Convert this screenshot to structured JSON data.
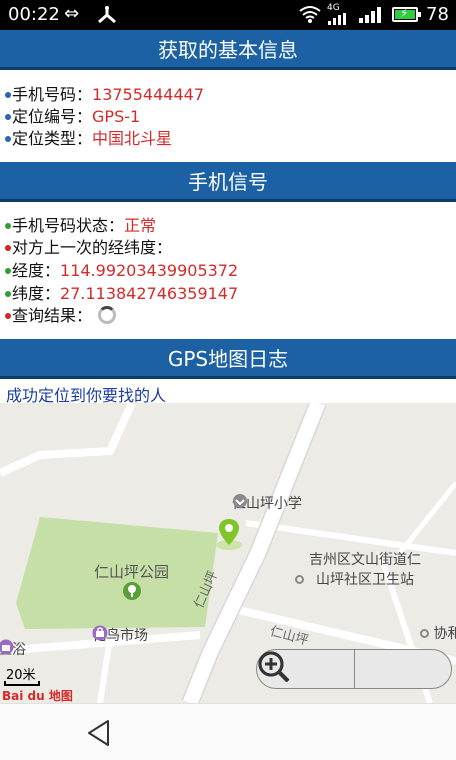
{
  "status_bar": {
    "time": "00:22",
    "network": "4G",
    "battery_level": "78"
  },
  "basic_info": {
    "title": "获取的基本信息",
    "rows": [
      {
        "label": "手机号码：",
        "value": "13755444447"
      },
      {
        "label": "定位编号：",
        "value": "GPS-1"
      },
      {
        "label": "定位类型：",
        "value": "中国北斗星"
      }
    ]
  },
  "phone_signal": {
    "title": "手机信号",
    "status_label": "手机号码状态：",
    "status_value": "正常",
    "last_coord_label": "对方上一次的经纬度：",
    "lon_label": "经度：",
    "lon_value": "114.99203439905372",
    "lat_label": "纬度：",
    "lat_value": "27.113842746359147",
    "query_label": "查询结果："
  },
  "gps_log": {
    "title": "GPS地图日志",
    "caption": "成功定位到你要找的人"
  },
  "map": {
    "poi_school": "仁山坪小学",
    "poi_park": "仁山坪公园",
    "poi_market": "花鸟市场",
    "poi_clinic_line1": "吉州区文山街道仁",
    "poi_clinic_line2": "山坪社区卫生站",
    "road_1": "仁山坪",
    "road_2": "仁山坪",
    "poi_bath": "卫浴",
    "poi_right": "协和",
    "scale": "20米",
    "logo": "Bai du 地图",
    "colors": {
      "park": "#c6dfa7",
      "road": "#ffffff",
      "marker": "#7dc52a"
    }
  },
  "theme": {
    "header_bg": "#1b61a3",
    "value_color": "#d62a2a",
    "caption_color": "#1b3f9e"
  }
}
